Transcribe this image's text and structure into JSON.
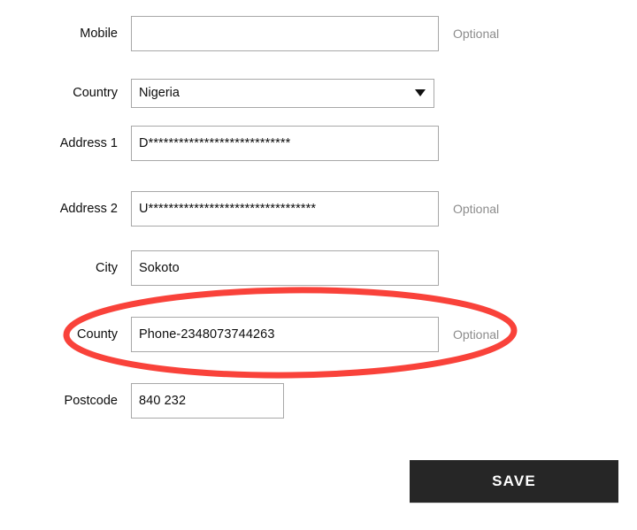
{
  "form": {
    "fields": [
      {
        "id": "mobile",
        "label": "Mobile",
        "type": "text",
        "value": "",
        "placeholder": "",
        "note": "Optional",
        "width": "wide"
      },
      {
        "id": "country",
        "label": "Country",
        "type": "select",
        "value": "Nigeria",
        "note": "",
        "width": "wide"
      },
      {
        "id": "address1",
        "label": "Address 1",
        "type": "text",
        "value": "D****************************",
        "placeholder": "",
        "note": "",
        "width": "wide"
      },
      {
        "id": "address2",
        "label": "Address 2",
        "type": "text",
        "value": "U*********************************",
        "placeholder": "",
        "note": "Optional",
        "width": "wide"
      },
      {
        "id": "city",
        "label": "City",
        "type": "text",
        "value": "Sokoto",
        "placeholder": "",
        "note": "",
        "width": "wide"
      },
      {
        "id": "county",
        "label": "County",
        "type": "text",
        "value": "Phone-2348073744263",
        "placeholder": "",
        "note": "Optional",
        "width": "wide"
      },
      {
        "id": "postcode",
        "label": "Postcode",
        "type": "text",
        "value": "840 232",
        "placeholder": "",
        "note": "",
        "width": "narrow"
      }
    ],
    "submit_label": "SAVE"
  },
  "annotation": {
    "shape": "ellipse",
    "color": "#F9423A",
    "stroke_width": 7,
    "target_field": "county"
  },
  "colors": {
    "field_border": "#a8a8a8",
    "text": "#0d0d0d",
    "muted_text": "#8c8c8c",
    "button_bg": "#262626",
    "button_text": "#ffffff",
    "annotation_red": "#F9423A",
    "background": "#ffffff"
  },
  "icons": {
    "dropdown": "chevron-down-icon"
  }
}
